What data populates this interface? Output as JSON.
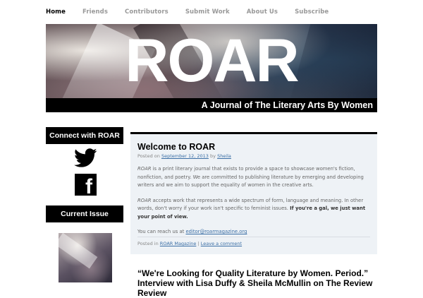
{
  "nav": {
    "items": [
      {
        "label": "Home",
        "active": true
      },
      {
        "label": "Friends",
        "active": false
      },
      {
        "label": "Contributors",
        "active": false
      },
      {
        "label": "Submit Work",
        "active": false
      },
      {
        "label": "About Us",
        "active": false
      },
      {
        "label": "Subscribe",
        "active": false
      }
    ]
  },
  "banner": {
    "title": "ROAR",
    "tagline": "A Journal of The Literary Arts By Women"
  },
  "sidebar": {
    "connect_heading": "Connect with ROAR",
    "social_icons": [
      "twitter-icon",
      "facebook-icon"
    ],
    "facebook_glyph": "f",
    "current_issue_heading": "Current Issue"
  },
  "post": {
    "title": "Welcome to ROAR",
    "meta_prefix": "Posted on",
    "date": "September 12, 2013",
    "by": "by",
    "author": "Sheila",
    "para1_em": "ROAR",
    "para1_rest": " is a print literary journal that exists to provide a space to showcase women's fiction, nonfiction, and poetry. We are committed to publishing literature by emerging and developing writers and we aim to support the equality of women in the creative arts.",
    "para2_em": "ROAR",
    "para2_rest": " accepts work that represents a wide spectrum of form, language and meaning.  In other words, don't worry if your work isn't specific to feminist issues. ",
    "para2_bold": "If you're a gal, we just want your point of view.",
    "contact_prefix": "You can reach us at ",
    "contact_email": "editor@roarmagazine.org",
    "footer_prefix": "Posted in",
    "category": "ROAR Magazine",
    "separator": "|",
    "comment_link": "Leave a comment"
  },
  "next_post": {
    "title": "“We're Looking for Quality Literature by Women. Period.” Interview with Lisa Duffy & Sheila McMullin on The Review Review"
  },
  "colors": {
    "nav_active": "#000000",
    "nav_inactive": "#999999",
    "link": "#3a6ea5",
    "post_bg": "#eef2f6"
  }
}
